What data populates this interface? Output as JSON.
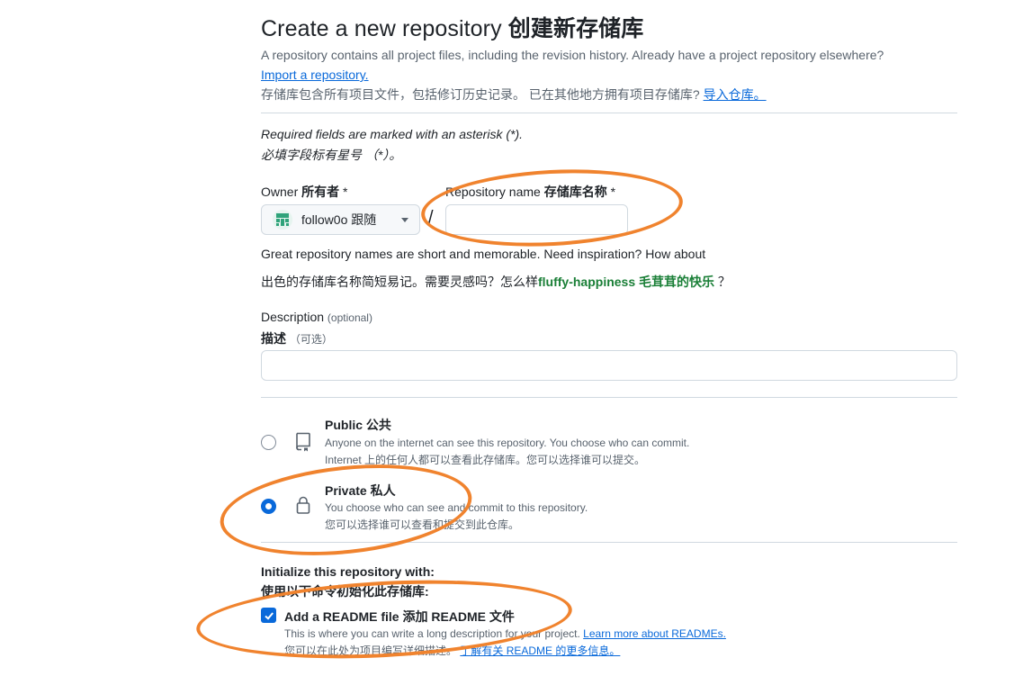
{
  "header": {
    "title": "Create a new repository",
    "title_zh": "创建新存储库"
  },
  "intro": {
    "text": "A repository contains all project files, including the revision history. Already have a project repository elsewhere?",
    "import_link": "Import a repository.",
    "text_zh": "存储库包含所有项目文件，包括修订历史记录。 已在其他地方拥有项目存储库?",
    "import_link_zh": "导入仓库。"
  },
  "required_note": {
    "en": "Required fields are marked with an asterisk (*).",
    "zh": "必填字段标有星号 （*）。"
  },
  "owner": {
    "label": "Owner",
    "label_zh": "所有者",
    "asterisk": "*",
    "value": "follow0o 跟随",
    "icon": "identicon-avatar"
  },
  "separator": "/",
  "repo_name": {
    "label": "Repository name",
    "label_zh": "存储库名称",
    "asterisk": "*",
    "value": ""
  },
  "name_hint": {
    "en": "Great repository names are short and memorable. Need inspiration? How about",
    "zh": "出色的存储库名称简短易记。需要灵感吗？怎么样",
    "suggestion": "fluffy-happiness 毛茸茸的快乐",
    "end": " ？"
  },
  "description": {
    "label": "Description",
    "optional": "(optional)",
    "label_zh": "描述",
    "optional_zh": "（可选）",
    "value": ""
  },
  "visibility": {
    "public": {
      "title": "Public 公共",
      "desc": "Anyone on the internet can see this repository. You choose who can commit.",
      "desc_zh": "Internet 上的任何人都可以查看此存储库。您可以选择谁可以提交。",
      "icon": "repo-book-icon",
      "checked": false
    },
    "private": {
      "title": "Private 私人",
      "desc": "You choose who can see and commit to this repository.",
      "desc_zh": "您可以选择谁可以查看和提交到此仓库。",
      "icon": "lock-icon",
      "checked": true
    }
  },
  "initialize": {
    "label": "Initialize this repository with:",
    "label_zh": "使用以下命令初始化此存储库:",
    "readme": {
      "title": "Add a README file 添加 README 文件",
      "desc": "This is where you can write a long description for your project.",
      "link": "Learn more about READMEs.",
      "desc_zh": "您可以在此处为项目编写详细描述。",
      "link_zh": "了解有关 README 的更多信息。",
      "checked": true
    }
  },
  "colors": {
    "accent": "#0969da",
    "suggestion": "#1a7f37",
    "annotation": "#f0832e"
  }
}
